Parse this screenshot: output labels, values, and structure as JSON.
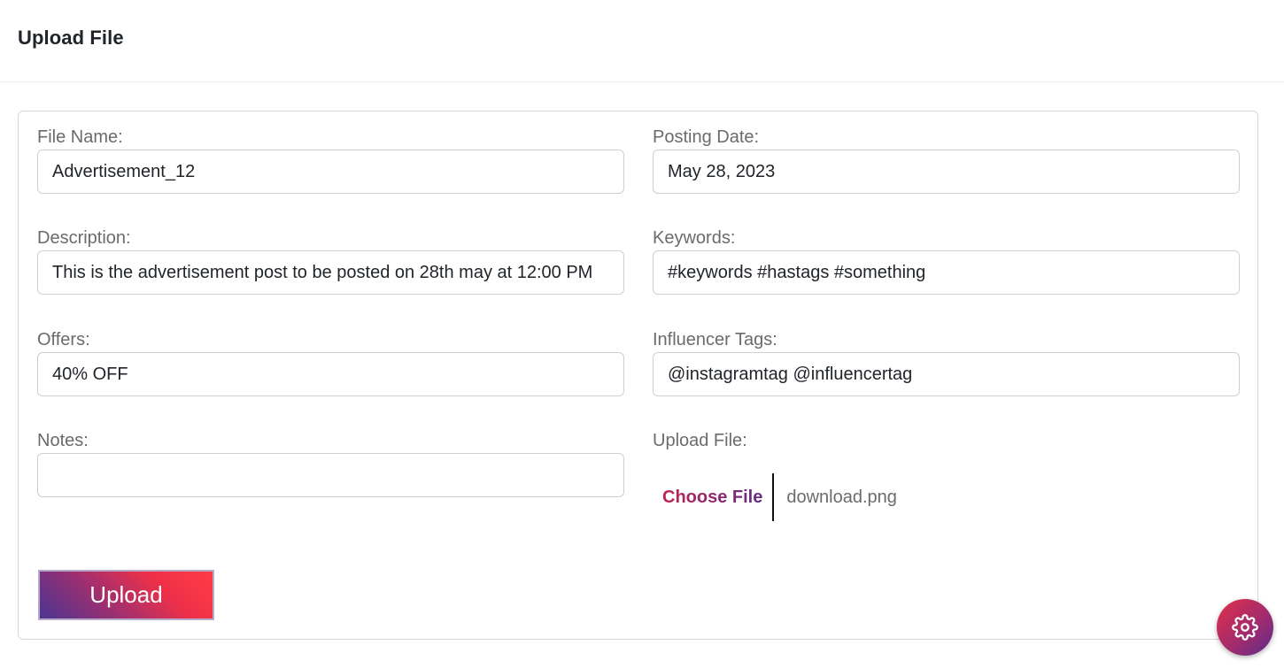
{
  "header": {
    "title": "Upload File"
  },
  "form": {
    "file_name": {
      "label": "File Name:",
      "value": "Advertisement_12"
    },
    "posting_date": {
      "label": "Posting Date:",
      "value": "May 28, 2023"
    },
    "description": {
      "label": "Description:",
      "value": "This is the advertisement post to be posted on 28th may at 12:00 PM"
    },
    "keywords": {
      "label": "Keywords:",
      "value": "#keywords #hastags #something"
    },
    "offers": {
      "label": "Offers:",
      "value": "40% OFF"
    },
    "influencer_tags": {
      "label": "Influencer Tags:",
      "value": "@instagramtag @influencertag"
    },
    "notes": {
      "label": "Notes:",
      "value": ""
    },
    "upload_file": {
      "label": "Upload File:",
      "choose_label": "Choose File",
      "file_name": "download.png"
    },
    "submit_label": "Upload"
  },
  "fab": {
    "icon": "gear-icon"
  },
  "colors": {
    "accent_red": "#ee3048",
    "accent_purple": "#4b3591"
  }
}
